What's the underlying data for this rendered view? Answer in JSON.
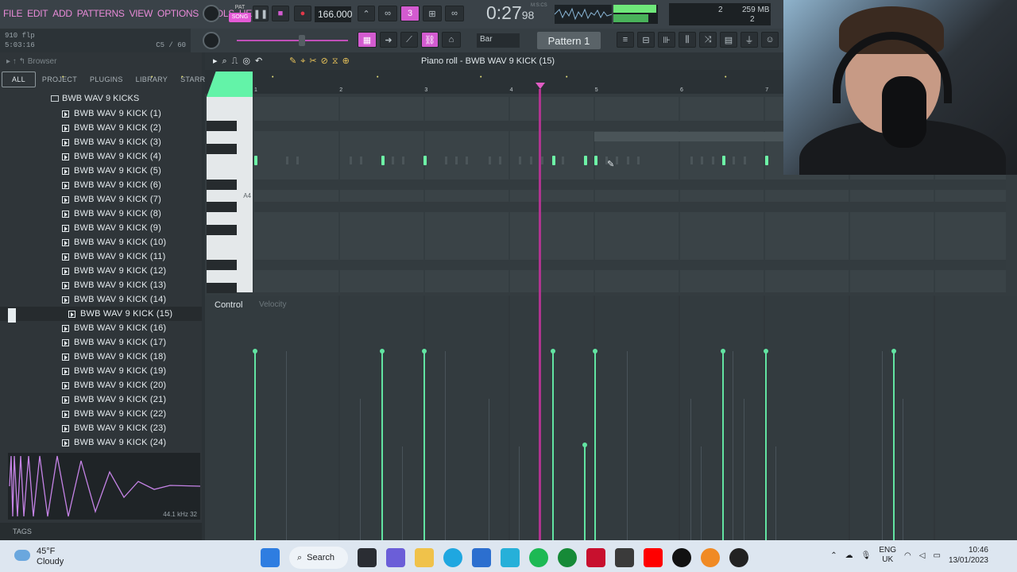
{
  "menu": [
    "FILE",
    "EDIT",
    "ADD",
    "PATTERNS",
    "VIEW",
    "OPTIONS",
    "TOOLS",
    "HELP"
  ],
  "transport": {
    "pat_label": "PAT",
    "song_label": "SONG",
    "tempo": "166.000",
    "time_main": "0:27",
    "time_small": "98",
    "time_unit": "M:S:CS",
    "cpu_value": "2",
    "ram": "259 MB",
    "poly": "2"
  },
  "hint": {
    "line1": "910 flp",
    "line2": "5:03:16",
    "line3": "C5 / 60"
  },
  "toolbar": {
    "snap_label": "Bar",
    "pattern_label": "Pattern 1"
  },
  "browser": {
    "header": "Browser",
    "tabs": [
      "ALL",
      "PROJECT",
      "PLUGINS",
      "LIBRARY",
      "STARRED"
    ],
    "folder": "BWB WAV 9 KICKS",
    "files": [
      "BWB WAV 9 KICK (1)",
      "BWB WAV 9 KICK (2)",
      "BWB WAV 9 KICK (3)",
      "BWB WAV 9 KICK (4)",
      "BWB WAV 9 KICK (5)",
      "BWB WAV 9 KICK (6)",
      "BWB WAV 9 KICK (7)",
      "BWB WAV 9 KICK (8)",
      "BWB WAV 9 KICK (9)",
      "BWB WAV 9 KICK (10)",
      "BWB WAV 9 KICK (11)",
      "BWB WAV 9 KICK (12)",
      "BWB WAV 9 KICK (13)",
      "BWB WAV 9 KICK (14)",
      "BWB WAV 9 KICK (15)",
      "BWB WAV 9 KICK (16)",
      "BWB WAV 9 KICK (17)",
      "BWB WAV 9 KICK (18)",
      "BWB WAV 9 KICK (19)",
      "BWB WAV 9 KICK (20)",
      "BWB WAV 9 KICK (21)",
      "BWB WAV 9 KICK (22)",
      "BWB WAV 9 KICK (23)",
      "BWB WAV 9 KICK (24)"
    ],
    "selected_index": 14,
    "wave_info": "44.1 kHz 32",
    "tags_label": "TAGS"
  },
  "piano_roll": {
    "title": "Piano roll - BWB WAV 9 KICK (15)",
    "bar_numbers": [
      "1",
      "2",
      "3",
      "4",
      "5",
      "6",
      "7"
    ],
    "key_label": "A4",
    "control_label": "Control",
    "velocity_label": "Velocity"
  },
  "taskbar": {
    "weather_temp": "45°F",
    "weather_desc": "Cloudy",
    "search_label": "Search",
    "lang": "ENG",
    "region": "UK",
    "time": "10:46",
    "date": "13/01/2023"
  },
  "colors": {
    "accent_pink": "#e45ad6",
    "note_green": "#6df2a6",
    "playhead": "#b0348f"
  }
}
